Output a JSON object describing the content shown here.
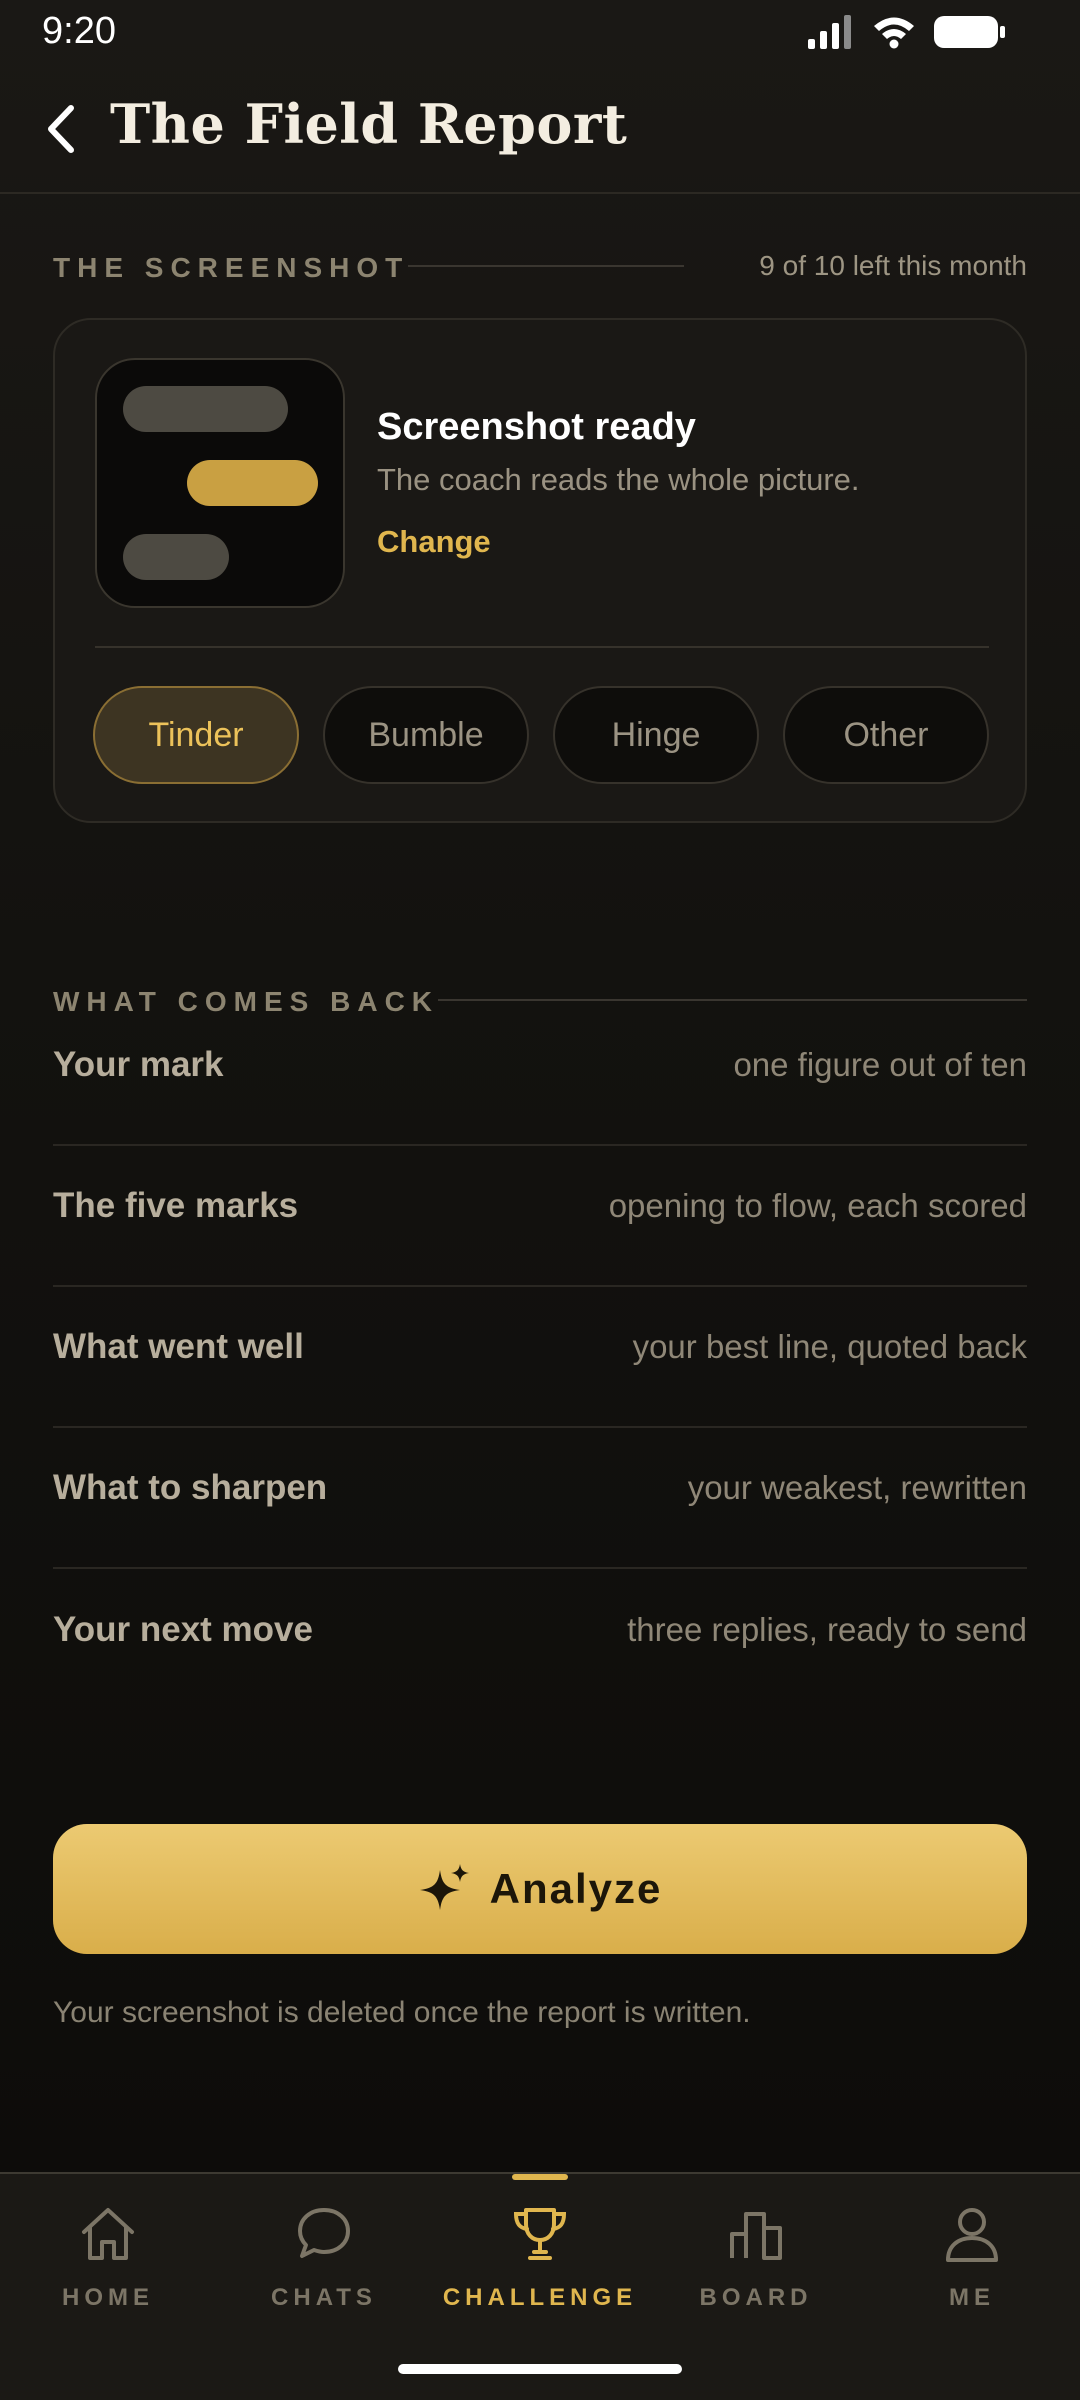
{
  "status_bar": {
    "time": "9:20"
  },
  "header": {
    "title": "The Field Report"
  },
  "screenshot_section": {
    "label": "THE SCREENSHOT",
    "count_text": "9 of 10 left this month",
    "card": {
      "title": "Screenshot ready",
      "subtitle": "The coach reads the whole picture.",
      "change_label": "Change"
    },
    "platforms": [
      {
        "label": "Tinder",
        "selected": true
      },
      {
        "label": "Bumble",
        "selected": false
      },
      {
        "label": "Hinge",
        "selected": false
      },
      {
        "label": "Other",
        "selected": false
      }
    ]
  },
  "results_section": {
    "label": "WHAT COMES BACK",
    "rows": [
      {
        "name": "Your mark",
        "desc": "one figure out of ten"
      },
      {
        "name": "The five marks",
        "desc": "opening to flow, each scored"
      },
      {
        "name": "What went well",
        "desc": "your best line, quoted back"
      },
      {
        "name": "What to sharpen",
        "desc": "your weakest, rewritten"
      },
      {
        "name": "Your next move",
        "desc": "three replies, ready to send"
      }
    ]
  },
  "analyze_button": {
    "label": "Analyze",
    "icon": "sparkles-icon"
  },
  "note": "Your screenshot is deleted once the report is written.",
  "bottom_nav": {
    "items": [
      {
        "label": "HOME",
        "icon": "home-icon",
        "active": false
      },
      {
        "label": "CHATS",
        "icon": "chat-icon",
        "active": false
      },
      {
        "label": "CHALLENGE",
        "icon": "trophy-icon",
        "active": true
      },
      {
        "label": "BOARD",
        "icon": "bar-chart-icon",
        "active": false
      },
      {
        "label": "ME",
        "icon": "person-icon",
        "active": false
      }
    ]
  },
  "colors": {
    "accent": "#e0b64e",
    "background": "#13120f",
    "card": "#1a1815"
  }
}
